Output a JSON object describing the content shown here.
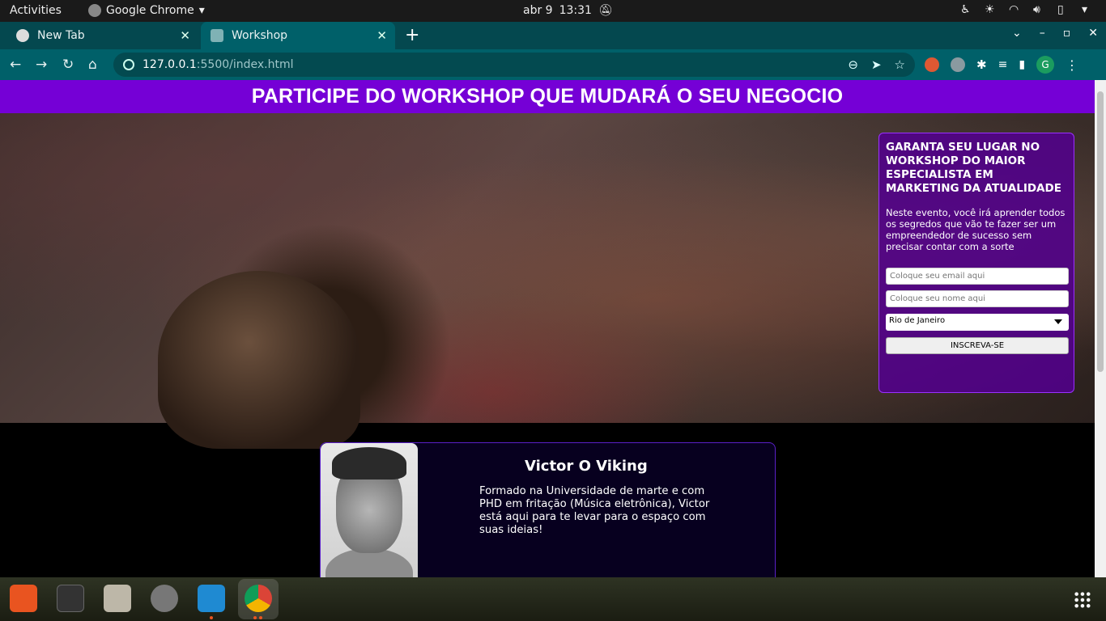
{
  "topbar": {
    "activities": "Activities",
    "app_name": "Google Chrome",
    "date": "abr 9",
    "time": "13:31"
  },
  "browser": {
    "tabs": [
      {
        "title": "New Tab",
        "active": false
      },
      {
        "title": "Workshop",
        "active": true
      }
    ],
    "url_host": "127.0.0.1",
    "url_path": ":5500/index.html",
    "profile_initial": "G"
  },
  "page": {
    "banner_title": "PARTICIPE DO WORKSHOP QUE MUDARÁ O SEU NEGOCIO",
    "signup": {
      "heading": "GARANTA SEU LUGAR NO WORKSHOP DO MAIOR ESPECIALISTA EM MARKETING DA ATUALIDADE",
      "description": "Neste evento, você irá aprender todos os segredos que vão te fazer ser um empreendedor de sucesso sem precisar contar com a sorte",
      "email_placeholder": "Coloque seu email aqui",
      "name_placeholder": "Coloque seu nome aqui",
      "city_selected": "Rio de Janeiro",
      "submit_label": "INSCREVA-SE"
    },
    "speaker": {
      "name": "Victor O Viking",
      "bio": "Formado na Universidade de marte e com PHD em fritação (Música eletrônica), Victor está aqui para te levar para o espaço com suas ideias!"
    }
  },
  "colors": {
    "banner": "#7500d6",
    "chrome_toolbar": "#006069",
    "chrome_tabstrip": "#04484f"
  }
}
